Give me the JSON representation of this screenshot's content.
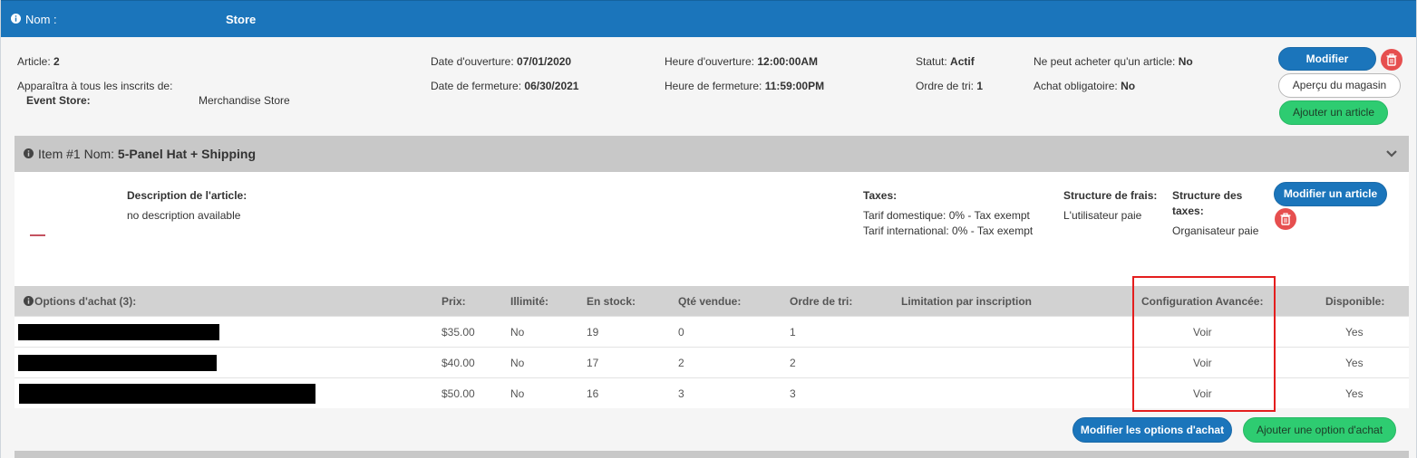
{
  "header": {
    "name_label": "Nom :",
    "store_name": "Store"
  },
  "store": {
    "article": {
      "label": "Article:",
      "value": "2"
    },
    "visible_to_label": "Apparaîtra à tous les inscrits de:",
    "event_store": {
      "label": "Event Store:",
      "value": "Merchandise Store"
    },
    "open_date": {
      "label": "Date d'ouverture:",
      "value": "07/01/2020"
    },
    "close_date": {
      "label": "Date de fermeture:",
      "value": "06/30/2021"
    },
    "open_time": {
      "label": "Heure d'ouverture:",
      "value": "12:00:00AM"
    },
    "close_time": {
      "label": "Heure de fermeture:",
      "value": "11:59:00PM"
    },
    "status": {
      "label": "Statut:",
      "value": "Actif"
    },
    "sort_order": {
      "label": "Ordre de tri:",
      "value": "1"
    },
    "single_item": {
      "label": "Ne peut acheter qu'un article:",
      "value": "No"
    },
    "mandatory": {
      "label": "Achat obligatoire:",
      "value": "No"
    },
    "buttons": {
      "modify": "Modifier",
      "preview": "Aperçu du magasin",
      "add_article": "Ajouter un article"
    }
  },
  "item": {
    "prefix": "Item #1 Nom:",
    "name": "5-Panel Hat + Shipping",
    "description_label": "Description de l'article:",
    "description": "no description available",
    "taxes_label": "Taxes:",
    "domestic": "Tarif domestique: 0% - Tax exempt",
    "international": "Tarif international: 0% - Tax exempt",
    "fee_structure_label": "Structure de frais:",
    "fee_structure_value": "L'utilisateur paie",
    "tax_structure_label_1": "Structure des",
    "tax_structure_label_2": "taxes:",
    "tax_structure_value": "Organisateur paie",
    "modify_button": "Modifier un article"
  },
  "options": {
    "headers": {
      "options": "Options d'achat (3):",
      "price": "Prix:",
      "unlimited": "Illimité:",
      "stock": "En stock:",
      "sold": "Qté vendue:",
      "sort": "Ordre de tri:",
      "limit": "Limitation par inscription",
      "advanced": "Configuration Avancée:",
      "available": "Disponible:"
    },
    "rows": [
      {
        "price": "$35.00",
        "unlimited": "No",
        "stock": "19",
        "sold": "0",
        "sort": "1",
        "advanced": "Voir",
        "available": "Yes"
      },
      {
        "price": "$40.00",
        "unlimited": "No",
        "stock": "17",
        "sold": "2",
        "sort": "2",
        "advanced": "Voir",
        "available": "Yes"
      },
      {
        "price": "$50.00",
        "unlimited": "No",
        "stock": "16",
        "sold": "3",
        "sort": "3",
        "advanced": "Voir",
        "available": "Yes"
      }
    ],
    "buttons": {
      "modify": "Modifier les options d'achat",
      "add": "Ajouter une option d'achat"
    }
  },
  "colors": {
    "header": "#1b75bb",
    "green": "#2ecc71",
    "danger": "#e64f4f",
    "highlight": "#e41e1e"
  }
}
